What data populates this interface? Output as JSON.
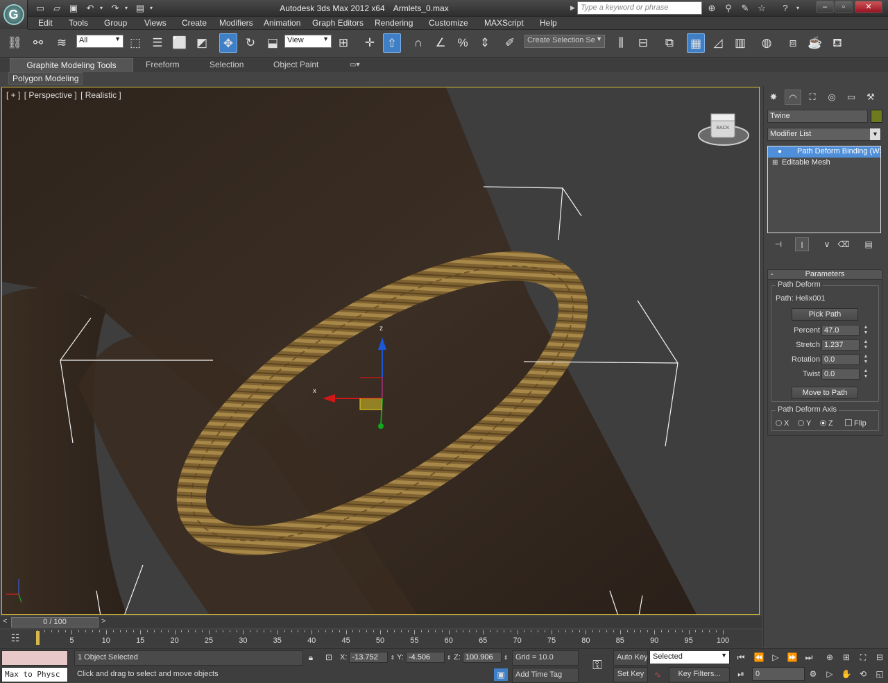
{
  "titlebar": {
    "app_name": "Autodesk 3ds Max  2012 x64",
    "file_name": "Armlets_0.max",
    "search_placeholder": "Type a keyword or phrase",
    "logo_letter": "G"
  },
  "menu": [
    "Edit",
    "Tools",
    "Group",
    "Views",
    "Create",
    "Modifiers",
    "Animation",
    "Graph Editors",
    "Rendering",
    "Customize",
    "MAXScript",
    "Help"
  ],
  "toolbar": {
    "selection_filter": "All",
    "ref_coord": "View",
    "named_selection": "Create Selection Se"
  },
  "ribbon": {
    "tabs": [
      "Graphite Modeling Tools",
      "Freeform",
      "Selection",
      "Object Paint"
    ],
    "sub_tab": "Polygon Modeling"
  },
  "viewport": {
    "label_parts": [
      "[ + ]",
      "[ Perspective ]",
      "[ Realistic ]"
    ],
    "viewcube_label": "BACK",
    "gizmo_x": "x",
    "gizmo_z": "z"
  },
  "command_panel": {
    "object_name": "Twine",
    "object_color": "#6e7a1e",
    "modifier_list": "Modifier List",
    "stack": [
      "Path Deform Binding (WSM)",
      "Editable Mesh"
    ],
    "rollout_title": "Parameters",
    "path_deform_group": "Path Deform",
    "path_label": "Path: Helix001",
    "pick_path": "Pick Path",
    "params": [
      {
        "label": "Percent",
        "value": "47.0"
      },
      {
        "label": "Stretch",
        "value": "1.237"
      },
      {
        "label": "Rotation",
        "value": "0.0"
      },
      {
        "label": "Twist",
        "value": "0.0"
      }
    ],
    "move_to_path": "Move to Path",
    "axis_group": "Path Deform Axis",
    "axis_options": [
      "X",
      "Y",
      "Z"
    ],
    "axis_selected": "Z",
    "flip_label": "Flip"
  },
  "timeline": {
    "slider_text": "0 / 100",
    "ticks": [
      "5",
      "10",
      "15",
      "20",
      "25",
      "30",
      "35",
      "40",
      "45",
      "50",
      "55",
      "60",
      "65",
      "70",
      "75",
      "80",
      "85",
      "90",
      "95",
      "100"
    ]
  },
  "status": {
    "listener_text": "Max to Physc",
    "selection_info": "1 Object Selected",
    "prompt": "Click and drag to select and move objects",
    "x_label": "X:",
    "x_value": "-13.752",
    "y_label": "Y:",
    "y_value": "-4.506",
    "z_label": "Z:",
    "z_value": "100.906",
    "grid": "Grid = 10.0",
    "add_time_tag": "Add Time Tag",
    "auto_key": "Auto Key",
    "set_key": "Set Key",
    "key_mode": "Selected",
    "key_filters": "Key Filters...",
    "frame": "0"
  },
  "colors": {
    "accent_blue": "#3f7fc6",
    "viewport_border": "#d9c03a",
    "rope": "#8a6a30",
    "skin": "#3a2d22"
  }
}
